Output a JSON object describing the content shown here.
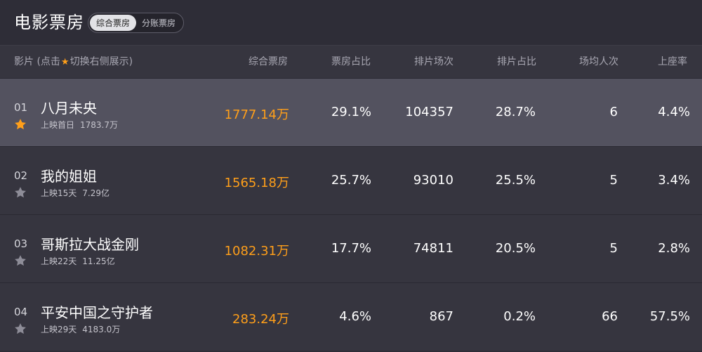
{
  "header": {
    "title": "电影票房",
    "toggle": [
      "综合票房",
      "分账票房"
    ],
    "active_toggle": 0
  },
  "columns": {
    "film_prefix": "影片 (点击",
    "film_suffix": "切换右侧展示)",
    "boxoffice": "综合票房",
    "box_share": "票房占比",
    "screenings": "排片场次",
    "screening_share": "排片占比",
    "avg_attendance": "场均人次",
    "occupancy": "上座率"
  },
  "rows": [
    {
      "rank": "01",
      "name": "八月未央",
      "sub_label": "上映首日",
      "sub_value": "1783.7万",
      "boxoffice": "1777.14万",
      "box_share": "29.1%",
      "screenings": "104357",
      "screening_share": "28.7%",
      "avg_attendance": "6",
      "occupancy": "4.4%",
      "starred": true,
      "highlight": true
    },
    {
      "rank": "02",
      "name": "我的姐姐",
      "sub_label": "上映15天",
      "sub_value": "7.29亿",
      "boxoffice": "1565.18万",
      "box_share": "25.7%",
      "screenings": "93010",
      "screening_share": "25.5%",
      "avg_attendance": "5",
      "occupancy": "3.4%",
      "starred": false,
      "highlight": false
    },
    {
      "rank": "03",
      "name": "哥斯拉大战金刚",
      "sub_label": "上映22天",
      "sub_value": "11.25亿",
      "boxoffice": "1082.31万",
      "box_share": "17.7%",
      "screenings": "74811",
      "screening_share": "20.5%",
      "avg_attendance": "5",
      "occupancy": "2.8%",
      "starred": false,
      "highlight": false
    },
    {
      "rank": "04",
      "name": "平安中国之守护者",
      "sub_label": "上映29天",
      "sub_value": "4183.0万",
      "boxoffice": "283.24万",
      "box_share": "4.6%",
      "screenings": "867",
      "screening_share": "0.2%",
      "avg_attendance": "66",
      "occupancy": "57.5%",
      "starred": false,
      "highlight": false
    }
  ],
  "colors": {
    "accent": "#ff9f1a",
    "star_inactive": "#8e8d98",
    "background": "#2e2d37",
    "row": "#36353f",
    "row_highlight": "#53525f"
  },
  "icons": {
    "star_active": "star-filled-icon",
    "star_inactive": "star-outline-icon"
  }
}
